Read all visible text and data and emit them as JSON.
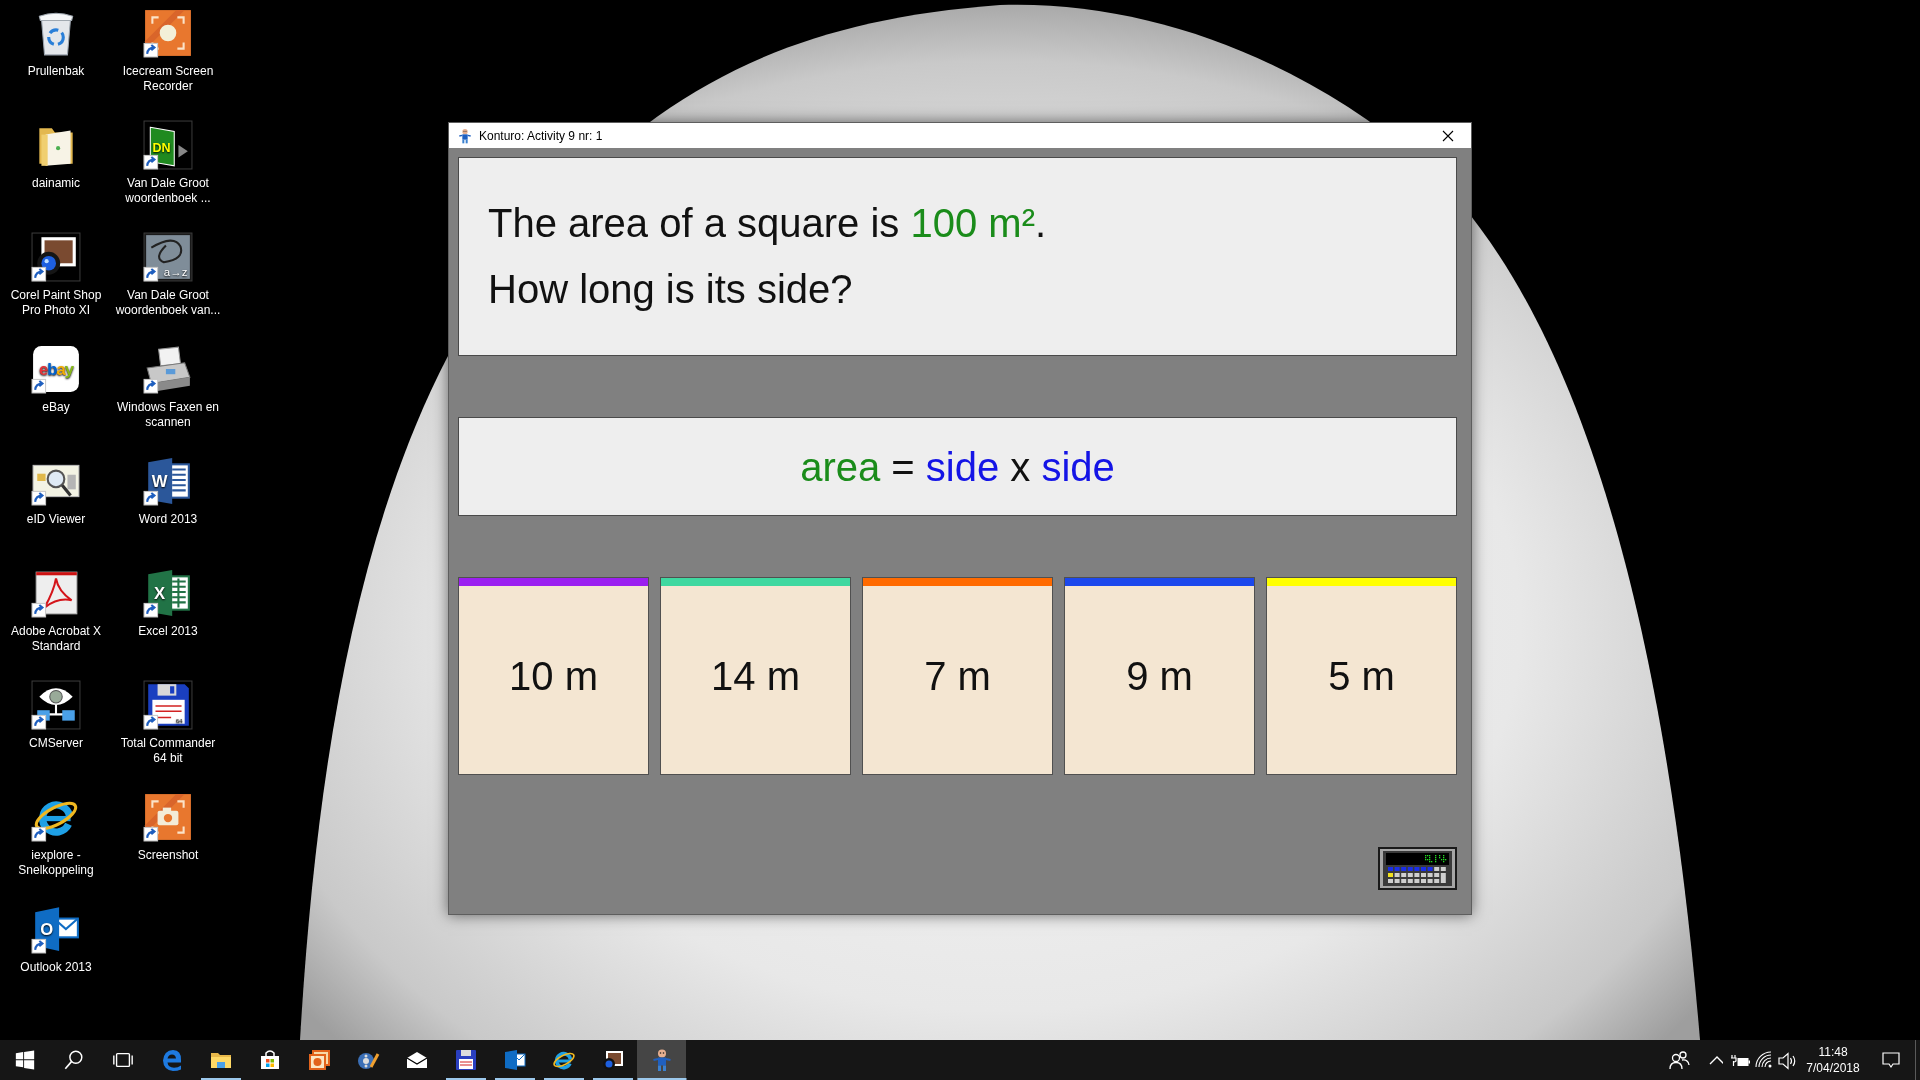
{
  "desktop_icons": [
    {
      "label": "Prullenbak",
      "kind": "trash",
      "shortcut": false
    },
    {
      "label": "dainamic",
      "kind": "folder",
      "shortcut": false
    },
    {
      "label": "Corel Paint Shop Pro Photo XI",
      "kind": "lens-photo",
      "shortcut": true
    },
    {
      "label": "eBay",
      "kind": "ebay",
      "shortcut": true,
      "glyph": "ebay"
    },
    {
      "label": "eID Viewer",
      "kind": "id-card",
      "shortcut": true
    },
    {
      "label": "Adobe Acrobat X Standard",
      "kind": "pdf",
      "shortcut": true
    },
    {
      "label": "CMServer",
      "kind": "network-eye",
      "shortcut": true
    },
    {
      "label": "iexplore - Snelkoppeling",
      "kind": "ie",
      "shortcut": true
    },
    {
      "label": "Outlook 2013",
      "kind": "outlook",
      "shortcut": true,
      "glyph": "O"
    },
    {
      "label": "Icecream Screen Recorder",
      "kind": "recorder",
      "shortcut": true
    },
    {
      "label": "Van Dale Groot woordenboek ...",
      "kind": "book",
      "shortcut": true,
      "glyph": "DN"
    },
    {
      "label": "Van Dale Groot woordenboek van...",
      "kind": "scribble",
      "shortcut": true,
      "glyph": "a→z"
    },
    {
      "label": "Windows Faxen en scannen",
      "kind": "fax",
      "shortcut": true
    },
    {
      "label": "Word 2013",
      "kind": "word",
      "shortcut": true,
      "glyph": "W"
    },
    {
      "label": "Excel 2013",
      "kind": "excel",
      "shortcut": true,
      "glyph": "X"
    },
    {
      "label": "Total Commander 64 bit",
      "kind": "floppy",
      "shortcut": true,
      "glyph": "64"
    },
    {
      "label": "Screenshot",
      "kind": "camera-tile",
      "shortcut": true
    }
  ],
  "window": {
    "title": "Konturo: Activity 9 nr: 1",
    "question": {
      "lines": [
        {
          "parts": [
            {
              "text": "The area of a square is ",
              "kind": "plain"
            },
            {
              "text": "100 m²",
              "kind": "given"
            },
            {
              "text": ".",
              "kind": "plain"
            }
          ]
        },
        {
          "parts": [
            {
              "text": "How long is its side?",
              "kind": "plain"
            }
          ]
        }
      ]
    },
    "formula": {
      "parts": [
        {
          "text": "area",
          "kind": "given"
        },
        {
          "text": " = ",
          "kind": "plain"
        },
        {
          "text": "side",
          "kind": "unknown"
        },
        {
          "text": " x ",
          "kind": "plain"
        },
        {
          "text": "side",
          "kind": "unknown"
        }
      ]
    },
    "answers": [
      {
        "label": "10 m",
        "color": "#9b1ff0",
        "selected": false
      },
      {
        "label": "14 m",
        "color": "#3fd8a0",
        "selected": false
      },
      {
        "label": "7 m",
        "color": "#ff6a00",
        "selected": false
      },
      {
        "label": "9 m",
        "color": "#1c48ec",
        "selected": false
      },
      {
        "label": "5 m",
        "color": "#ffff00",
        "selected": false
      }
    ]
  },
  "taskbar": {
    "system_buttons": [
      {
        "kind": "start"
      },
      {
        "kind": "search"
      },
      {
        "kind": "task-view"
      }
    ],
    "apps": [
      {
        "kind": "edge",
        "running": false,
        "selected": false
      },
      {
        "kind": "explorer",
        "running": true,
        "selected": false
      },
      {
        "kind": "store",
        "running": false,
        "selected": false
      },
      {
        "kind": "frame",
        "running": false,
        "selected": false
      },
      {
        "kind": "reel",
        "running": false,
        "selected": false
      },
      {
        "kind": "mail",
        "running": false,
        "selected": false
      },
      {
        "kind": "floppy",
        "running": true,
        "selected": false
      },
      {
        "kind": "outlook",
        "running": true,
        "selected": false
      },
      {
        "kind": "ie",
        "running": true,
        "selected": false
      },
      {
        "kind": "lens",
        "running": true,
        "selected": false
      },
      {
        "kind": "figure",
        "running": true,
        "selected": true
      }
    ],
    "tray": {
      "icons": [
        {
          "kind": "people"
        },
        {
          "kind": "chevron"
        },
        {
          "kind": "battery"
        },
        {
          "kind": "wifi"
        },
        {
          "kind": "volume"
        }
      ],
      "time": "11:48",
      "date": "7/04/2018"
    }
  }
}
